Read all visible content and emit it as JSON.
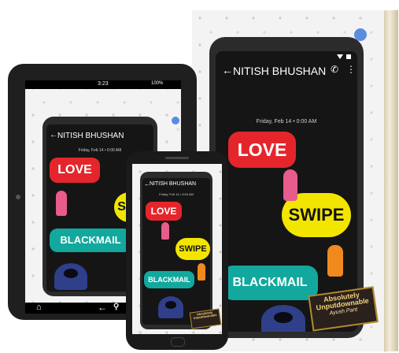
{
  "book": {
    "contact_name": "NITISH BHUSHAN",
    "timestamp": "Friday, Feb 14 • 0:00 AM",
    "bubble_love": "LOVE",
    "bubble_swipe": "SWIPE",
    "bubble_blackmail": "BLACKMAIL",
    "badge_line1": "Absolutely",
    "badge_line2": "Unputdownable",
    "badge_author": "Ayush Pant"
  },
  "tablet": {
    "status_time": "3:23",
    "status_battery": "100%"
  },
  "colors": {
    "love": "#e4262c",
    "swipe": "#f2e600",
    "blackmail": "#12a89d",
    "screen": "#151515"
  }
}
